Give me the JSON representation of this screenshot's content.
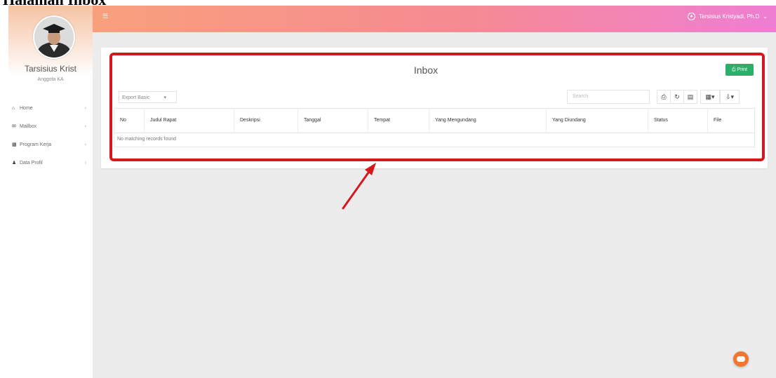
{
  "page": {
    "caption": "Halaman Inbox"
  },
  "sidebar": {
    "user_name": "Tarsisius Krist",
    "user_role": "Anggota KA",
    "items": [
      {
        "label": "Home",
        "icon": "home-icon"
      },
      {
        "label": "Mailbox",
        "icon": "envelope-icon"
      },
      {
        "label": "Program Kerja",
        "icon": "bar-chart-icon"
      },
      {
        "label": "Data Profil",
        "icon": "user-icon"
      }
    ]
  },
  "header": {
    "menu_icon": "hamburger-icon",
    "user_name": "Tarsisius Kristyadi, Ph.D"
  },
  "inbox": {
    "title": "Inbox",
    "print_label": "Print",
    "export_label": "Export Basic",
    "search_placeholder": "Search",
    "tools": [
      "print-icon",
      "refresh-icon",
      "toggle-columns-icon",
      "columns-icon",
      "export-icon"
    ],
    "columns": [
      "No",
      "Judul Rapat",
      "Deskripsi",
      "Tanggal",
      "Tempat",
      "Yang Mengundang",
      "Yang Diundang",
      "Status",
      "File"
    ],
    "empty_message": "No matching records found"
  },
  "colors": {
    "header_gradient_start": "#f8a07c",
    "header_gradient_end": "#ee7ed3",
    "highlight_border": "#d4181e",
    "print_button": "#2ab06a",
    "chat_button": "#f2762f"
  }
}
